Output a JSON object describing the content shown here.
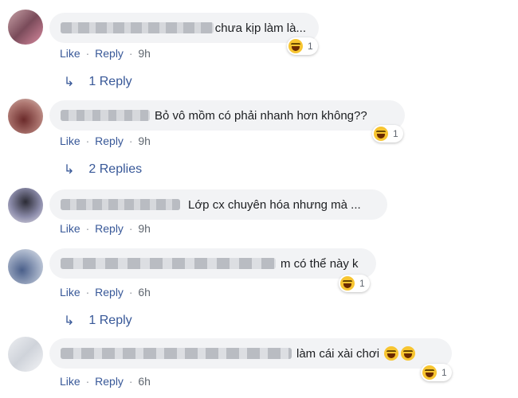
{
  "comments": [
    {
      "text": "chưa kịp làm là...",
      "time": "9h",
      "reactions": "1",
      "replies": "1 Reply"
    },
    {
      "text": "Bỏ vô mồm có phải nhanh hơn không??",
      "time": "9h",
      "reactions": "1",
      "replies": "2 Replies"
    },
    {
      "text": "Lớp cx chuyên hóa nhưng mà ...",
      "time": "9h"
    },
    {
      "text": "m có thể này k",
      "time": "6h",
      "reactions": "1",
      "replies": "1 Reply"
    },
    {
      "text": "làm cái xài chơi",
      "time": "6h",
      "reactions": "1"
    }
  ],
  "actions": {
    "like": "Like",
    "reply": "Reply",
    "separator": "·"
  },
  "colors": {
    "bubble": "#f2f3f5",
    "link": "#385898",
    "meta": "#606770"
  }
}
